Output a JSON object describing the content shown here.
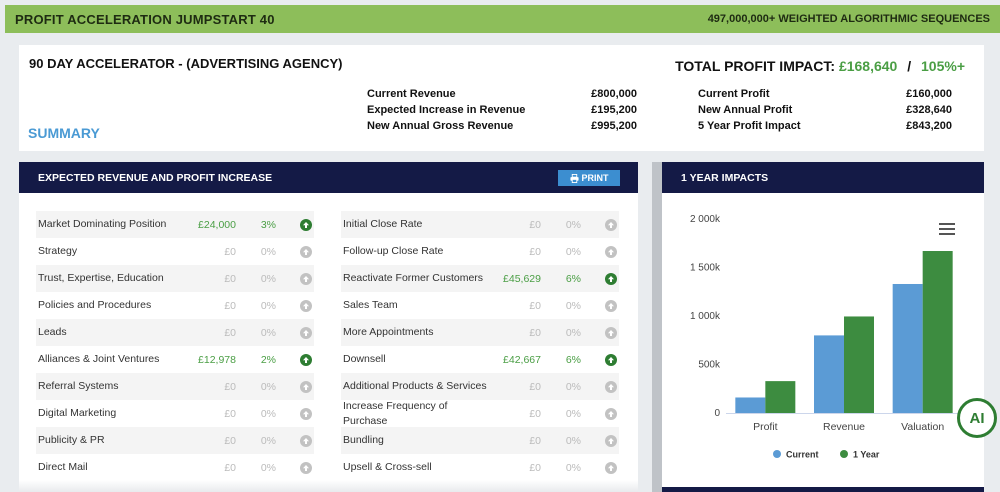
{
  "header": {
    "title": "PROFIT ACCELERATION JUMPSTART 40",
    "tagline": "497,000,000+ WEIGHTED ALGORITHMIC SEQUENCES"
  },
  "summary": {
    "title": "90 DAY ACCELERATOR - (ADVERTISING AGENCY)",
    "section_label": "SUMMARY",
    "impact_label": "TOTAL PROFIT IMPACT:",
    "impact_value": "£168,640",
    "impact_sep": "/",
    "impact_pct": "105%+",
    "revenue": [
      {
        "label": "Current Revenue",
        "value": "£800,000"
      },
      {
        "label": "Expected Increase in Revenue",
        "value": "£195,200"
      },
      {
        "label": "New Annual Gross Revenue",
        "value": "£995,200"
      }
    ],
    "profit": [
      {
        "label": "Current Profit",
        "value": "£160,000"
      },
      {
        "label": "New Annual Profit",
        "value": "£328,640"
      },
      {
        "label": "5 Year Profit Impact",
        "value": "£843,200"
      }
    ]
  },
  "increase_panel": {
    "title": "EXPECTED REVENUE AND PROFIT INCREASE",
    "print_label": "PRINT",
    "left": [
      {
        "label": "Market Dominating Position",
        "amount": "£24,000",
        "pct": "3%",
        "active": true
      },
      {
        "label": "Strategy",
        "amount": "£0",
        "pct": "0%",
        "active": false
      },
      {
        "label": "Trust, Expertise, Education",
        "amount": "£0",
        "pct": "0%",
        "active": false
      },
      {
        "label": "Policies and Procedures",
        "amount": "£0",
        "pct": "0%",
        "active": false
      },
      {
        "label": "Leads",
        "amount": "£0",
        "pct": "0%",
        "active": false
      },
      {
        "label": "Alliances & Joint Ventures",
        "amount": "£12,978",
        "pct": "2%",
        "active": true
      },
      {
        "label": "Referral Systems",
        "amount": "£0",
        "pct": "0%",
        "active": false
      },
      {
        "label": "Digital Marketing",
        "amount": "£0",
        "pct": "0%",
        "active": false
      },
      {
        "label": "Publicity & PR",
        "amount": "£0",
        "pct": "0%",
        "active": false
      },
      {
        "label": "Direct Mail",
        "amount": "£0",
        "pct": "0%",
        "active": false
      }
    ],
    "right": [
      {
        "label": "Initial Close Rate",
        "amount": "£0",
        "pct": "0%",
        "active": false
      },
      {
        "label": "Follow-up Close Rate",
        "amount": "£0",
        "pct": "0%",
        "active": false
      },
      {
        "label": "Reactivate Former Customers",
        "amount": "£45,629",
        "pct": "6%",
        "active": true
      },
      {
        "label": "Sales Team",
        "amount": "£0",
        "pct": "0%",
        "active": false
      },
      {
        "label": "More Appointments",
        "amount": "£0",
        "pct": "0%",
        "active": false
      },
      {
        "label": "Downsell",
        "amount": "£42,667",
        "pct": "6%",
        "active": true
      },
      {
        "label": "Additional Products & Services",
        "amount": "£0",
        "pct": "0%",
        "active": false
      },
      {
        "label": "Increase Frequency of Purchase",
        "amount": "£0",
        "pct": "0%",
        "active": false
      },
      {
        "label": "Bundling",
        "amount": "£0",
        "pct": "0%",
        "active": false
      },
      {
        "label": "Upsell & Cross-sell",
        "amount": "£0",
        "pct": "0%",
        "active": false
      }
    ]
  },
  "impacts_panel": {
    "title": "1 YEAR IMPACTS"
  },
  "ai_label": "AI",
  "icons": {
    "print": "printer-icon",
    "arrow": "arrow-up-circle-icon",
    "menu": "hamburger-menu-icon"
  },
  "colors": {
    "topbar": "#8dbe5a",
    "navy": "#141a46",
    "accent_blue": "#4a9ad4",
    "green": "#4a9e44",
    "current": "#5b9bd5",
    "one_year": "#3d8c40"
  },
  "chart_data": {
    "type": "bar",
    "categories": [
      "Profit",
      "Revenue",
      "Valuation"
    ],
    "series": [
      {
        "name": "Current",
        "values": [
          160000,
          800000,
          1330000
        ],
        "color": "#5b9bd5"
      },
      {
        "name": "1 Year",
        "values": [
          328640,
          995200,
          1670000
        ],
        "color": "#3d8c40"
      }
    ],
    "yticks": [
      "0",
      "500k",
      "1 000k",
      "1 500k",
      "2 000k"
    ],
    "ytick_values": [
      0,
      500000,
      1000000,
      1500000,
      2000000
    ],
    "ylim": [
      0,
      2000000
    ],
    "legend": "bottom",
    "grid": false
  }
}
